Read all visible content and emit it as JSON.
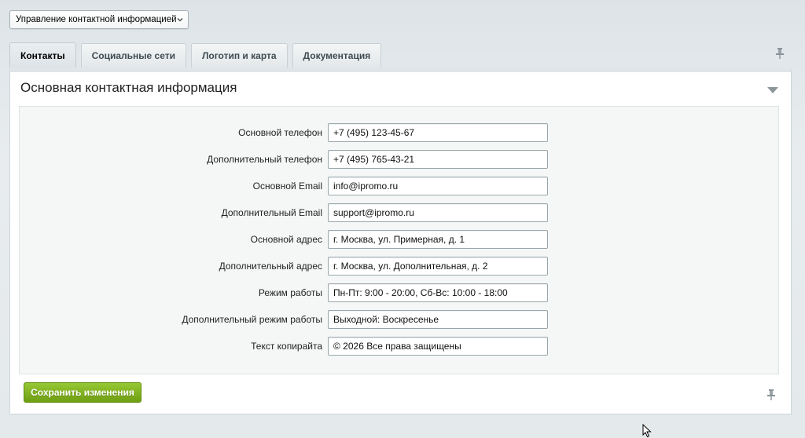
{
  "top_select": {
    "value": "Управление контактной информацией"
  },
  "tabs": [
    {
      "label": "Контакты",
      "active": true
    },
    {
      "label": "Социальные сети",
      "active": false
    },
    {
      "label": "Логотип и карта",
      "active": false
    },
    {
      "label": "Документация",
      "active": false
    }
  ],
  "section": {
    "title": "Основная контактная информация"
  },
  "fields": [
    {
      "label": "Основной телефон",
      "value": "+7 (495) 123-45-67"
    },
    {
      "label": "Дополнительный телефон",
      "value": "+7 (495) 765-43-21"
    },
    {
      "label": "Основной Email",
      "value": "info@ipromo.ru"
    },
    {
      "label": "Дополнительный Email",
      "value": "support@ipromo.ru"
    },
    {
      "label": "Основной адрес",
      "value": "г. Москва, ул. Примерная, д. 1"
    },
    {
      "label": "Дополнительный адрес",
      "value": "г. Москва, ул. Дополнительная, д. 2"
    },
    {
      "label": "Режим работы",
      "value": "Пн-Пт: 9:00 - 20:00, Сб-Вс: 10:00 - 18:00"
    },
    {
      "label": "Дополнительный режим работы",
      "value": "Выходной: Воскресенье"
    },
    {
      "label": "Текст копирайта",
      "value": "© 2026 Все права защищены"
    }
  ],
  "save_button": {
    "label": "Сохранить изменения"
  },
  "icons": {
    "select_chevron": "chevron-down-icon",
    "pin_top": "pin-icon",
    "collapse": "triangle-down-icon",
    "pin_bottom": "pin-icon",
    "cursor": "mouse-cursor-icon"
  },
  "colors": {
    "save_button": "#7fb01d",
    "panel_background": "#ffffff",
    "form_background": "#f4f7f6",
    "page_background": "#e4e9ec"
  }
}
